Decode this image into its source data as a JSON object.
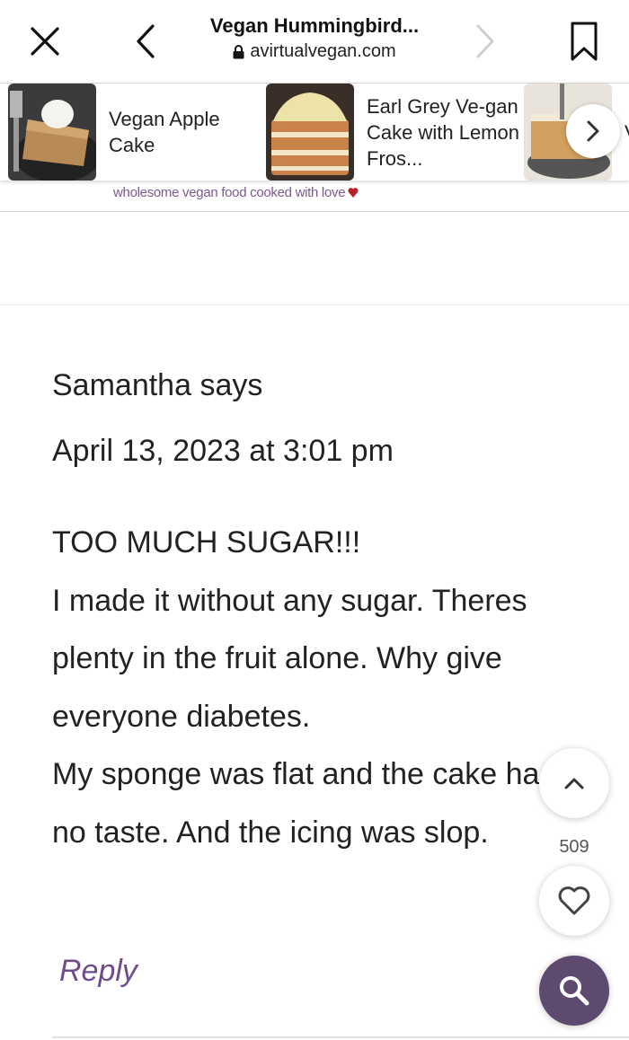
{
  "browser": {
    "title": "Vegan Hummingbird...",
    "url": "avirtualvegan.com",
    "icons": [
      "close-icon",
      "back-icon",
      "forward-icon",
      "lock-icon",
      "bookmark-icon"
    ]
  },
  "related": {
    "items": [
      {
        "label": "Vegan Apple Cake",
        "thumb": "apple-cake-thumb"
      },
      {
        "label": "Earl Grey Ve-gan Cake with Lemon Fros...",
        "thumb": "earl-grey-cake-thumb"
      },
      {
        "label": "V C",
        "thumb": "third-cake-thumb"
      }
    ],
    "next_icon": "chevron-right-icon"
  },
  "site": {
    "tagline": "wholesome vegan food cooked with love"
  },
  "comment": {
    "author_line": "Samantha says",
    "date": "April 13, 2023 at 3:01 pm",
    "lines": [
      "TOO MUCH SUGAR!!!",
      "I made it without any sugar. Theres plenty in the fruit alone. Why give everyone diabetes.",
      "My sponge was flat and the cake had no taste. And the icing was slop."
    ],
    "reply_label": "Reply"
  },
  "floating": {
    "like_count": "509",
    "icons": [
      "chevron-up-icon",
      "heart-icon",
      "search-icon"
    ]
  },
  "colors": {
    "accent": "#6f4d8c",
    "fab_dark": "#5e4a6e"
  }
}
